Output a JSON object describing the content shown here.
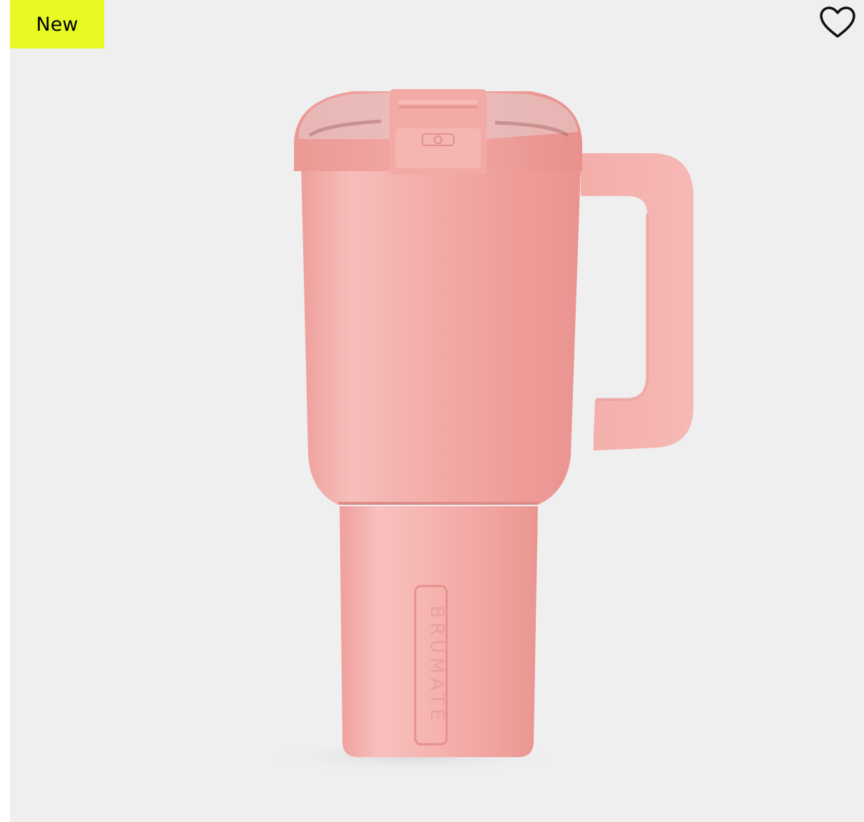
{
  "card": {
    "badge_label": "New",
    "wishlist_icon": "heart-outline-icon",
    "image_subject": "tumbler-mug",
    "image_logo_text": "BRÜMATE"
  },
  "colors": {
    "background": "#efeff0",
    "badge": "#e8f924",
    "product": "#f2a3a0"
  }
}
